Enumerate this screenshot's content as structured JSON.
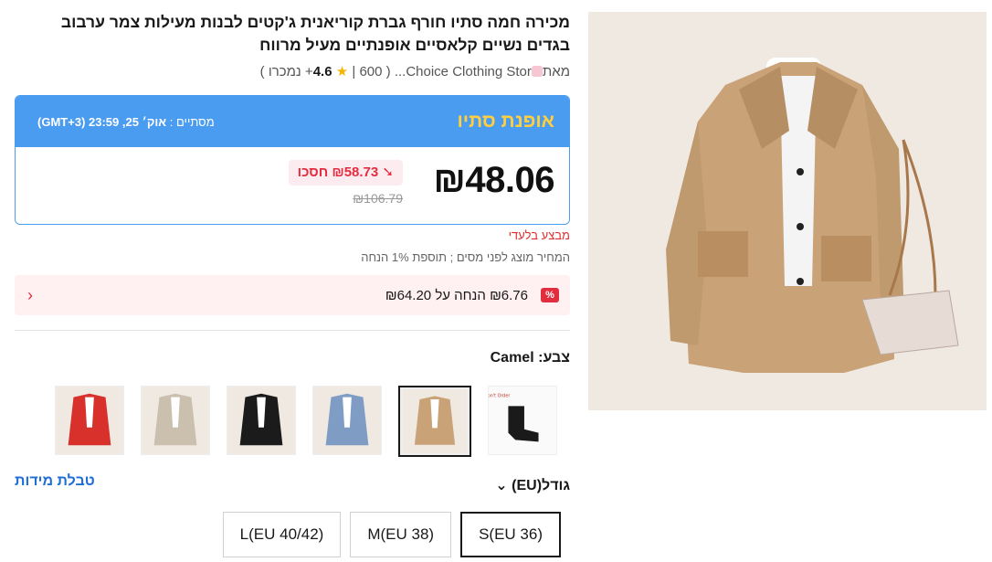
{
  "product": {
    "title": "מכירה חמה סתיו חורף גברת קוריאנית ג'קטים לבנות מעילות צמר ערבוב בגדים נשיים קלאסיים אופנתיים מעיל מרווח",
    "store_prefix": "מאת",
    "store_name": "Choice Clothing Stor...",
    "rating": "4.6",
    "rating_star": "★",
    "sold": "600+ נמכרו"
  },
  "sale": {
    "title": "אופנת סתיו",
    "ends_label": "מסתיים :",
    "ends_time": "אוק׳ 25, 23:59 (GMT+3)",
    "price": "₪48.06",
    "save": "₪58.73 חסכו",
    "save_icon": "arrow-down-icon",
    "old_price": "₪106.79"
  },
  "promo": {
    "seller_text": "מבצע בלעדי",
    "tax_note": "המחיר מוצג לפני מסים ; תוספת 1% הנחה",
    "coupon_badge": "%",
    "coupon_text": "₪6.76 הנחה על ₪64.20"
  },
  "color": {
    "label": "צבע:",
    "selected": "Camel",
    "swatches": [
      "socks",
      "camel",
      "blue",
      "black",
      "grey",
      "red"
    ]
  },
  "size": {
    "label": "גודל(EU)",
    "guide_label": "טבלת מידות",
    "options": [
      "S(EU 36)",
      "M(EU 38)",
      "L(EU 40/42)"
    ],
    "selected": "S(EU 36)"
  },
  "colors": {
    "accent_blue": "#4a9cf0",
    "sale_yellow": "#ffcf40",
    "red": "#e22d3f",
    "link_blue": "#1e6ed6"
  }
}
